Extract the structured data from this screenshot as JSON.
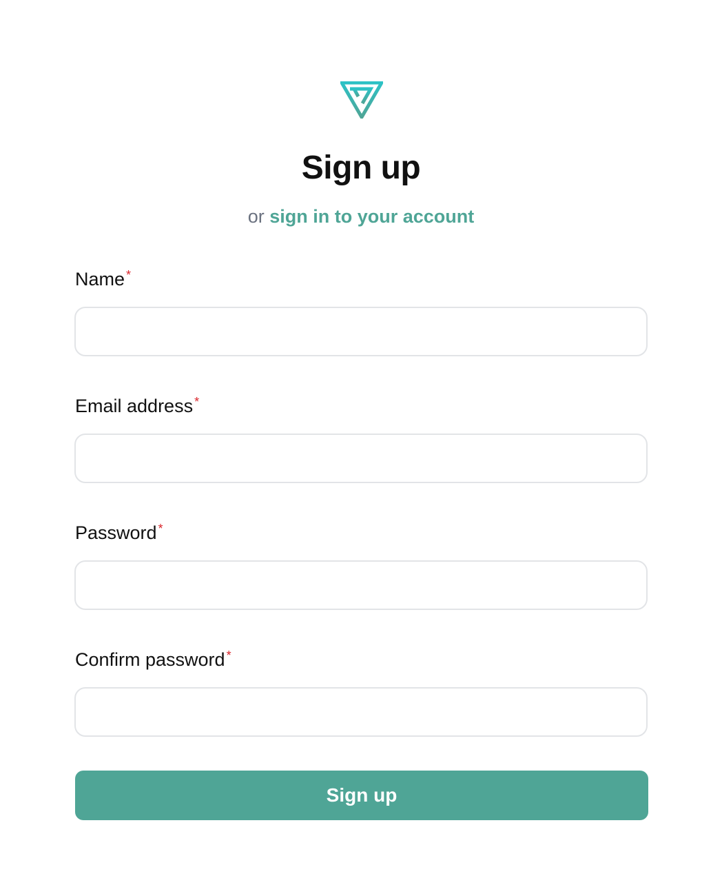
{
  "brand": {
    "logo_icon": "triangle-logo-icon",
    "colors": {
      "accent": "#4fa596",
      "logo_gradient_start": "#2cc2c6",
      "logo_gradient_end": "#4fa596",
      "required": "#d9262c",
      "text": "#111111",
      "muted": "#6b7280",
      "input_border": "#e2e4e7"
    }
  },
  "header": {
    "title": "Sign up",
    "subtitle_prefix": "or",
    "signin_link": "sign in to your account"
  },
  "form": {
    "required_marker": "*",
    "fields": [
      {
        "label": "Name",
        "value": "",
        "placeholder": ""
      },
      {
        "label": "Email address",
        "value": "",
        "placeholder": ""
      },
      {
        "label": "Password",
        "value": "",
        "placeholder": ""
      },
      {
        "label": "Confirm password",
        "value": "",
        "placeholder": ""
      }
    ],
    "submit_label": "Sign up"
  }
}
